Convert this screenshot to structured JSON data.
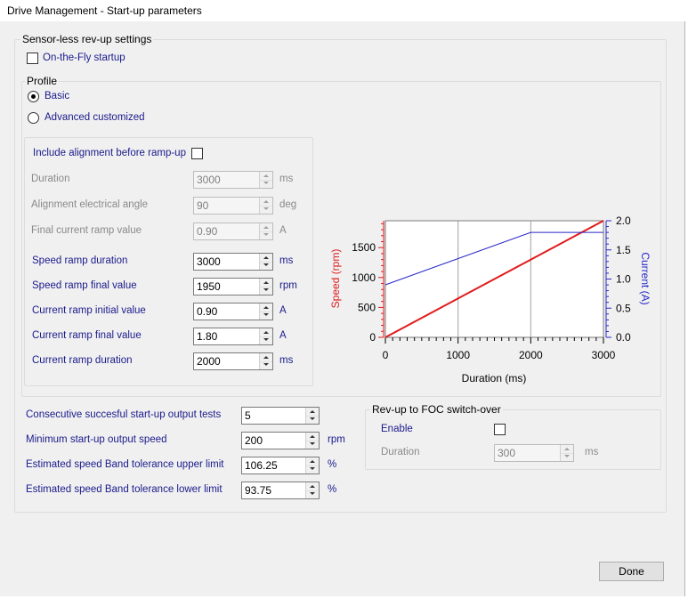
{
  "window": {
    "title": "Drive Management - Start-up parameters"
  },
  "sensorless": {
    "group_label": "Sensor-less rev-up settings",
    "on_the_fly": {
      "label": "On-the-Fly startup",
      "checked": false
    },
    "profile": {
      "group_label": "Profile",
      "basic_label": "Basic",
      "advanced_label": "Advanced customized",
      "selected": "Basic"
    },
    "params": {
      "alignment": {
        "label": "Include alignment before ramp-up",
        "checked": false
      },
      "duration": {
        "label": "Duration",
        "value": "3000",
        "unit": "ms"
      },
      "alignment_angle": {
        "label": "Alignment electrical angle",
        "value": "90",
        "unit": "deg"
      },
      "final_current_ramp": {
        "label": "Final current ramp value",
        "value": "0.90",
        "unit": "A"
      },
      "speed_ramp_duration": {
        "label": "Speed ramp duration",
        "value": "3000",
        "unit": "ms"
      },
      "speed_ramp_final": {
        "label": "Speed ramp final value",
        "value": "1950",
        "unit": "rpm"
      },
      "current_ramp_initial": {
        "label": "Current ramp initial value",
        "value": "0.90",
        "unit": "A"
      },
      "current_ramp_final": {
        "label": "Current ramp final value",
        "value": "1.80",
        "unit": "A"
      },
      "current_ramp_duration": {
        "label": "Current ramp duration",
        "value": "2000",
        "unit": "ms"
      }
    }
  },
  "tests": {
    "consecutive": {
      "label": "Consecutive succesful start-up output tests",
      "value": "5",
      "unit": ""
    },
    "min_speed": {
      "label": "Minimum start-up output speed",
      "value": "200",
      "unit": "rpm"
    },
    "band_upper": {
      "label": "Estimated speed Band tolerance upper limit",
      "value": "106.25",
      "unit": "%"
    },
    "band_lower": {
      "label": "Estimated speed Band tolerance lower limit",
      "value": "93.75",
      "unit": "%"
    }
  },
  "foc": {
    "group_label": "Rev-up to FOC switch-over",
    "enable": {
      "label": "Enable",
      "checked": false
    },
    "duration": {
      "label": "Duration",
      "value": "300",
      "unit": "ms"
    }
  },
  "done_label": "Done",
  "colors": {
    "speed": "#e01b1b",
    "current": "#2727c8",
    "label_blue": "#1a1a8c"
  },
  "chart_data": {
    "type": "line",
    "xlabel": "Duration (ms)",
    "ylabel": "Speed (rpm)",
    "y2label": "Current (A)",
    "xlim": [
      0,
      3000
    ],
    "ylim": [
      0,
      1950
    ],
    "y2lim": [
      0,
      2.0
    ],
    "x_ticks": [
      "0",
      "1000",
      "2000",
      "3000"
    ],
    "y_ticks": [
      "0",
      "500",
      "1000",
      "1500"
    ],
    "y2_ticks": [
      "0.0",
      "0.5",
      "1.0",
      "1.5",
      "2.0"
    ],
    "grid": true,
    "series": [
      {
        "axis": "left",
        "color": "#e01b1b",
        "x": [
          0,
          3000
        ],
        "y": [
          0,
          1950
        ]
      },
      {
        "axis": "right",
        "color": "#2727c8",
        "x": [
          0,
          2000,
          3000
        ],
        "y": [
          0.9,
          1.8,
          1.8
        ]
      }
    ]
  }
}
